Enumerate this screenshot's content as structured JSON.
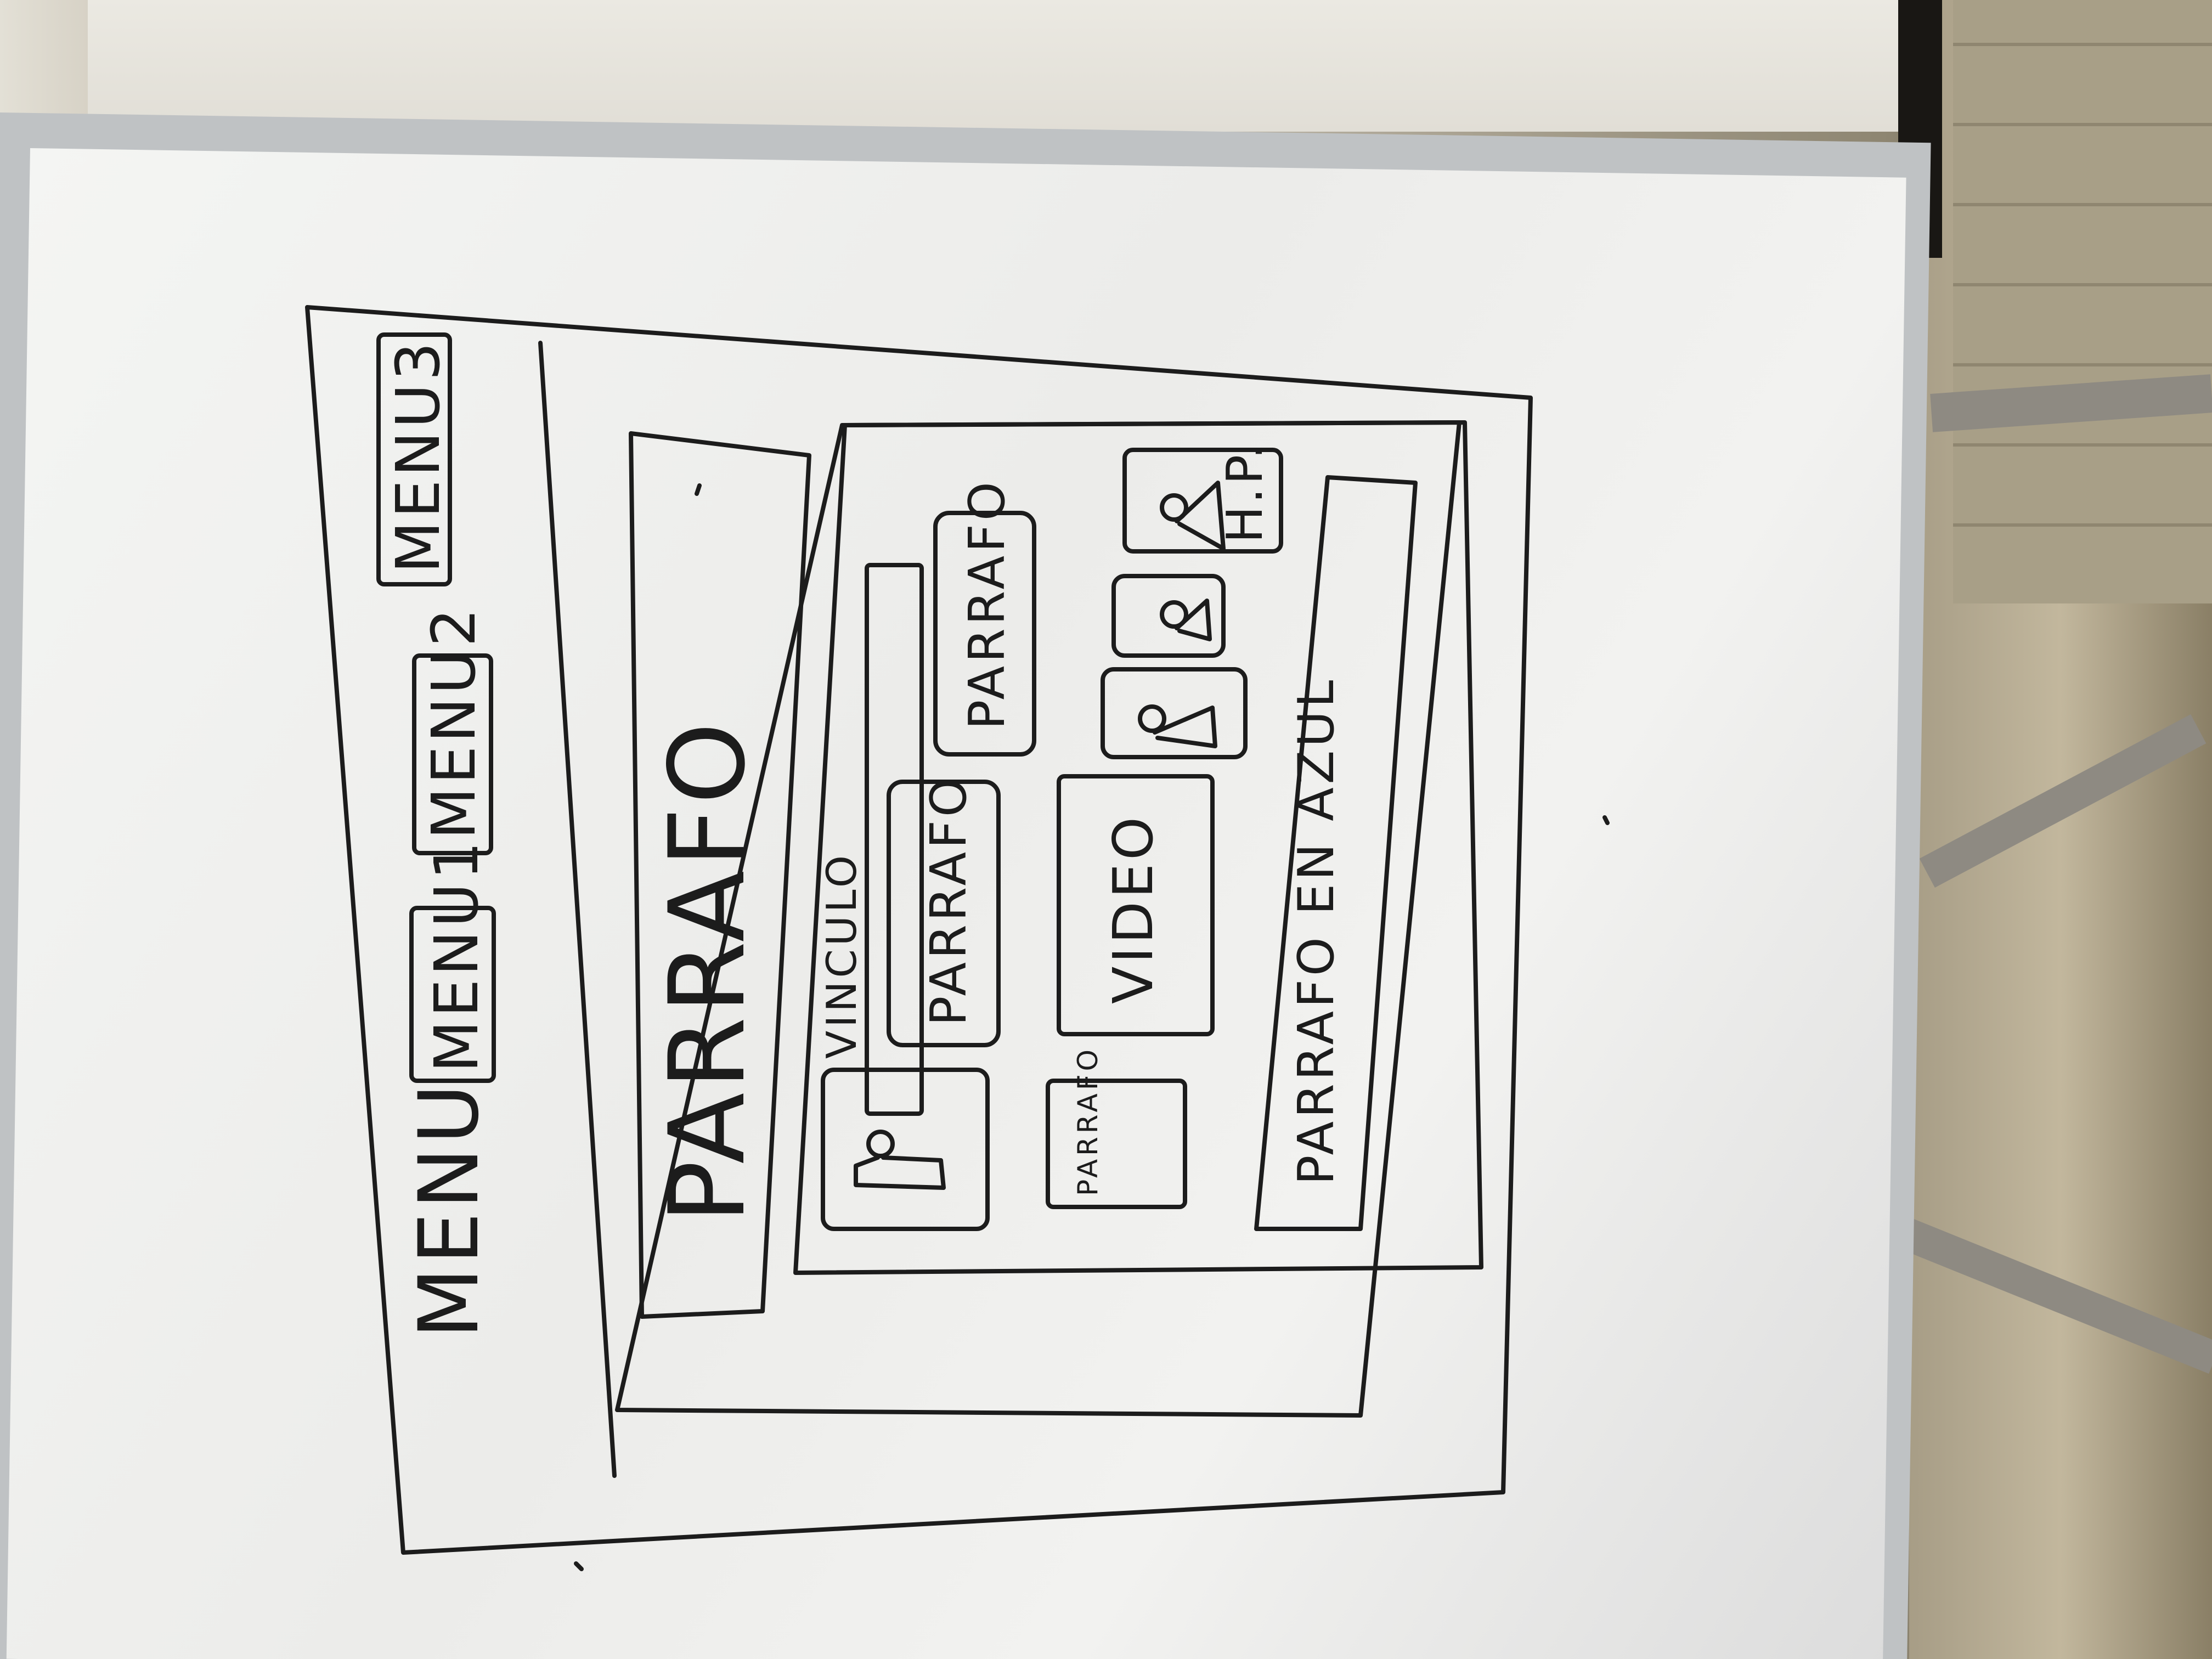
{
  "sketch": {
    "menu_bar": {
      "title": "MENU",
      "items": [
        "MENU1",
        "MENU2",
        "MENU3"
      ]
    },
    "hero": {
      "label": "PARRAFO"
    },
    "content": {
      "vinculo": "VINCULO",
      "parrafo_card": "PARRAFO",
      "parrafo_card_2": "PARRAFO",
      "image_icons": [
        "person-icon",
        "person-icon",
        "person-icon"
      ],
      "parrafo_small": "PARRAFO",
      "video": "VIDEO",
      "hip_label": "H.P.",
      "footer_text": "PARRAFO EN AZUL"
    }
  },
  "colors": {
    "ink": "#1c1c1c",
    "whiteboard": "#f2f2f0",
    "frame": "#bfc2c4"
  }
}
